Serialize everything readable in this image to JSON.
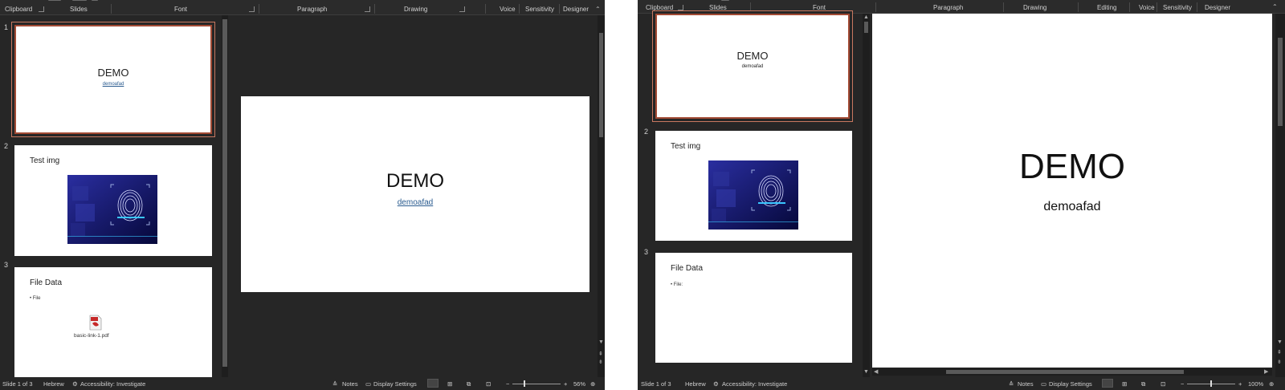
{
  "left": {
    "ribbon": {
      "clipboard": "Clipboard",
      "slides": "Slides",
      "font": "Font",
      "paragraph": "Paragraph",
      "drawing": "Drawing",
      "voice": "Voice",
      "sensitivity": "Sensitivity",
      "designer": "Designer"
    },
    "thumbs": [
      {
        "num": "1",
        "title": "DEMO",
        "sub": "demoafad"
      },
      {
        "num": "2",
        "title": "Test img"
      },
      {
        "num": "3",
        "title": "File Data",
        "bullet": "• File",
        "attachment": "basic-link-1.pdf"
      }
    ],
    "slide": {
      "title": "DEMO",
      "sub": "demoafad"
    },
    "status": {
      "slide_of": "Slide 1 of 3",
      "language": "Hebrew",
      "accessibility": "Accessibility: Investigate",
      "notes": "Notes",
      "display": "Display Settings",
      "zoom": "56%"
    }
  },
  "right": {
    "ribbon": {
      "clipboard": "Clipboard",
      "slides": "Slides",
      "font": "Font",
      "paragraph": "Paragraph",
      "drawing": "Drawing",
      "editing": "Editing",
      "voice": "Voice",
      "sensitivity": "Sensitivity",
      "designer": "Designer"
    },
    "thumbs": [
      {
        "num": "",
        "title": "DEMO",
        "sub": "demoafad"
      },
      {
        "num": "2",
        "title": "Test img"
      },
      {
        "num": "3",
        "title": "File Data",
        "bullet": "• File:"
      }
    ],
    "slide": {
      "title": "DEMO",
      "sub": "demoafad"
    },
    "status": {
      "slide_of": "Slide 1 of 3",
      "language": "Hebrew",
      "accessibility": "Accessibility: Investigate",
      "notes": "Notes",
      "display": "Display Settings",
      "zoom": "100%"
    }
  },
  "icons": [
    "fingerprint-image",
    "pdf-file-icon",
    "accessibility-icon",
    "notes-icon",
    "display-settings-icon",
    "normal-view-icon",
    "slide-sorter-icon",
    "reading-view-icon",
    "slideshow-icon",
    "fit-slide-icon",
    "chevron-up-icon"
  ]
}
